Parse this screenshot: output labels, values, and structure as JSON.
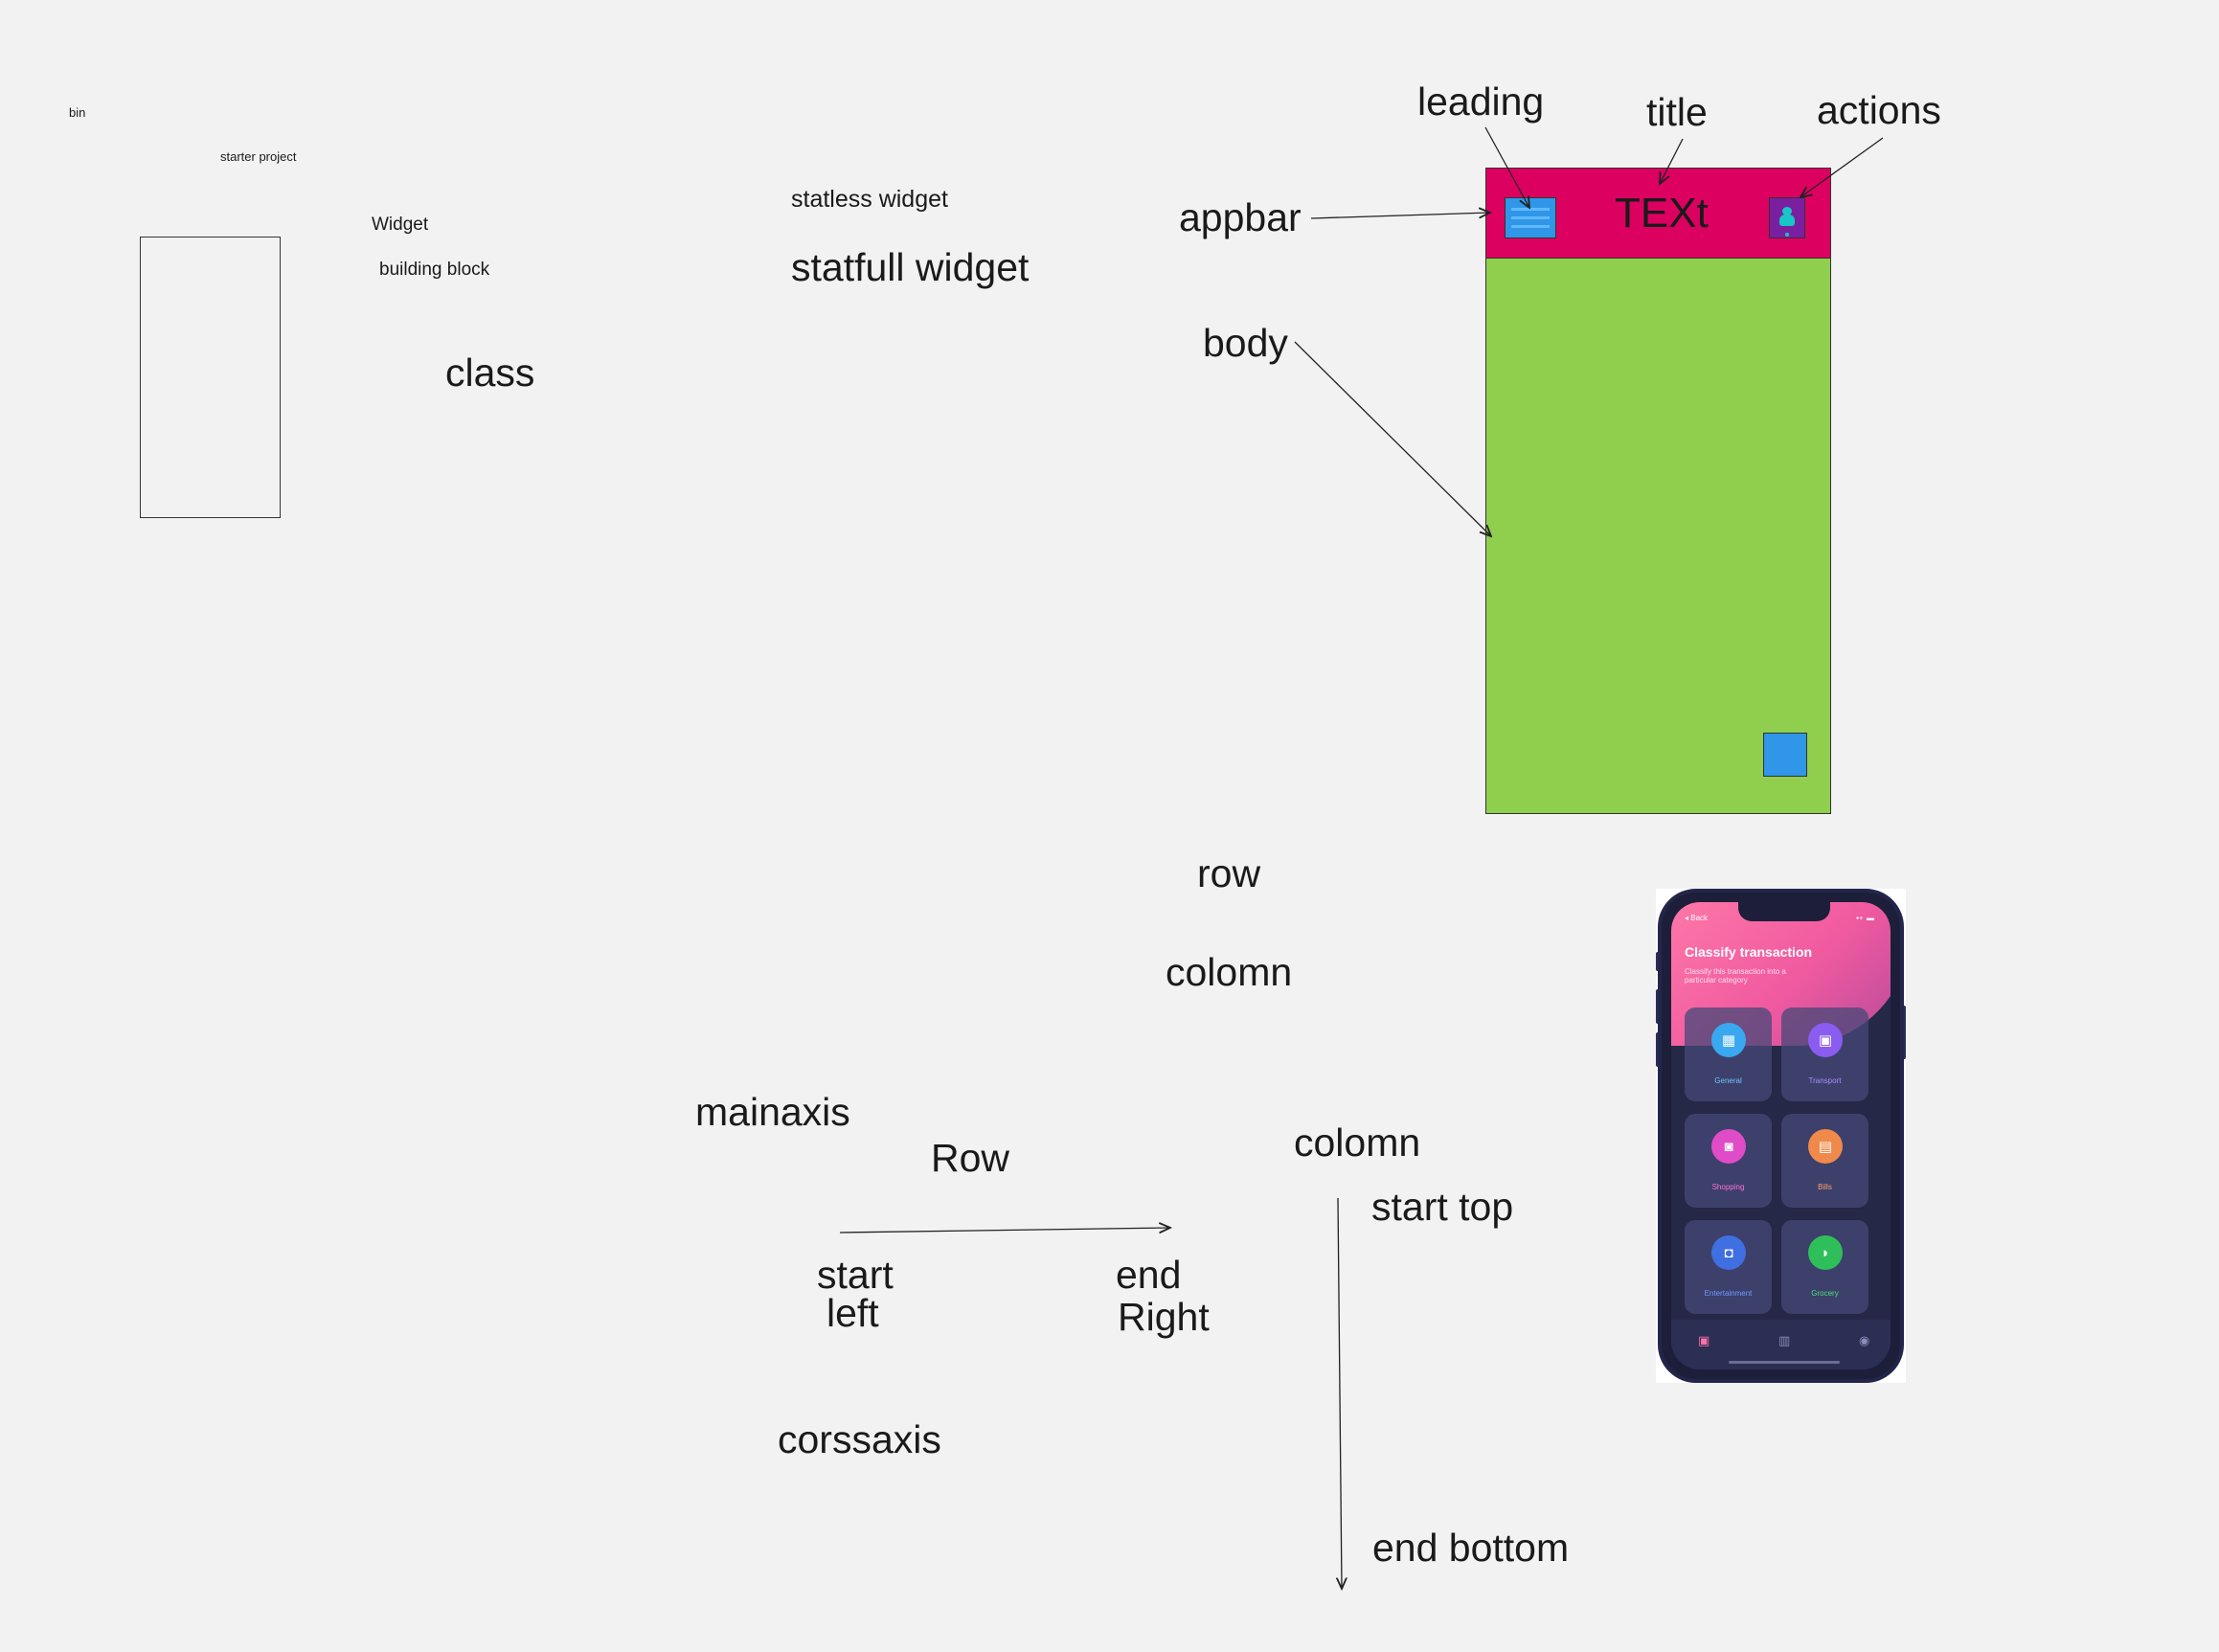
{
  "colors": {
    "canvas": "#f2f2f2",
    "appbar": "#dc0060",
    "body": "#8fcf4d",
    "accent_blue": "#2f96e8",
    "actions": "#7a1fa0"
  },
  "notes": {
    "bin": "bin",
    "starter_project": "starter project",
    "widget": "Widget",
    "building_block": "building block",
    "class": "class",
    "stateless_widget": "statless widget",
    "stateful_widget": "statfull widget"
  },
  "scaffold": {
    "labels": {
      "leading": "leading",
      "title": "title",
      "actions": "actions",
      "appbar": "appbar",
      "body": "body"
    },
    "appbar_title": "TEXt",
    "leading_icon": "menu-icon",
    "action_icon": "person-icon"
  },
  "layout_notes": {
    "row": "row",
    "colomn": "colomn",
    "mainaxis": "mainaxis",
    "row_title": "Row",
    "start_left": [
      "start",
      "left"
    ],
    "end_right": [
      "end",
      "Right"
    ],
    "corssaxis": "corssaxis",
    "colomn_title": "colomn",
    "start_top": "start top",
    "end_bottom": "end bottom"
  },
  "phone": {
    "back": "◂ Back",
    "title": "Classify transaction",
    "subtitle": "Classify this transaction into a particular category",
    "categories": [
      {
        "label": "General",
        "icon": "grid-icon",
        "glyph": "▦",
        "color": "#3aa8f0",
        "label_color": "#6cc4ff"
      },
      {
        "label": "Transport",
        "icon": "bus-icon",
        "glyph": "▣",
        "color": "#8b5cf0",
        "label_color": "#a88cff"
      },
      {
        "label": "Shopping",
        "icon": "bag-icon",
        "glyph": "◙",
        "color": "#e04cc8",
        "label_color": "#ff6fd8"
      },
      {
        "label": "Bills",
        "icon": "receipt-icon",
        "glyph": "▤",
        "color": "#f08a4a",
        "label_color": "#ffa070"
      },
      {
        "label": "Entertainment",
        "icon": "ticket-icon",
        "glyph": "◘",
        "color": "#3f6fe0",
        "label_color": "#6e9aff"
      },
      {
        "label": "Grocery",
        "icon": "leaf-icon",
        "glyph": "◗",
        "color": "#2fbf5a",
        "label_color": "#4fe07a"
      }
    ],
    "tabs": [
      {
        "icon": "wallet-icon",
        "glyph": "▣",
        "color": "#ff6fa8"
      },
      {
        "icon": "chart-icon",
        "glyph": "▥",
        "color": "#8a8db8"
      },
      {
        "icon": "profile-icon",
        "glyph": "◉",
        "color": "#8a8db8"
      }
    ]
  }
}
